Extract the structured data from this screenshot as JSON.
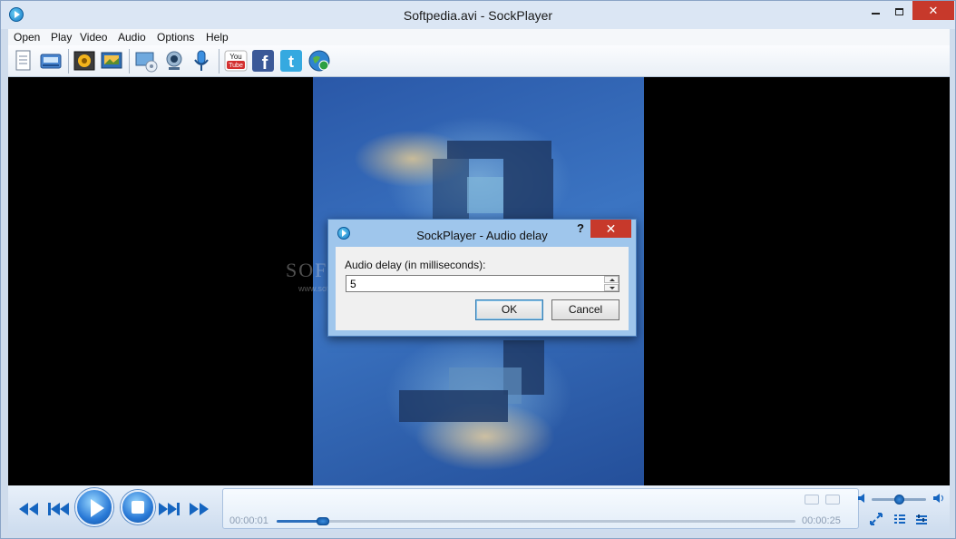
{
  "window": {
    "title": "Softpedia.avi - SockPlayer",
    "controls": {
      "minimize": "–",
      "maximize": "□",
      "close": "✕"
    }
  },
  "menu": {
    "items": [
      "Open",
      "Play",
      "Video",
      "Audio",
      "Options",
      "Help"
    ]
  },
  "toolbar": {
    "youtube_label": "You Tube",
    "facebook_label": "f"
  },
  "video": {
    "watermark": "SOFTPEDIA",
    "watermark_sub": "www.softpedia.com"
  },
  "dialog": {
    "title": "SockPlayer - Audio delay",
    "help": "?",
    "close": "✕",
    "label": "Audio delay (in milliseconds):",
    "value": "5",
    "ok": "OK",
    "cancel": "Cancel"
  },
  "playback": {
    "time_elapsed": "00:00:01",
    "time_total": "00:00:25",
    "progress_fraction": 0.04,
    "volume_fraction": 0.5
  },
  "colors": {
    "accent": "#1565c0",
    "close_button": "#c7392b",
    "dialog_frame": "#9fc6ec"
  }
}
